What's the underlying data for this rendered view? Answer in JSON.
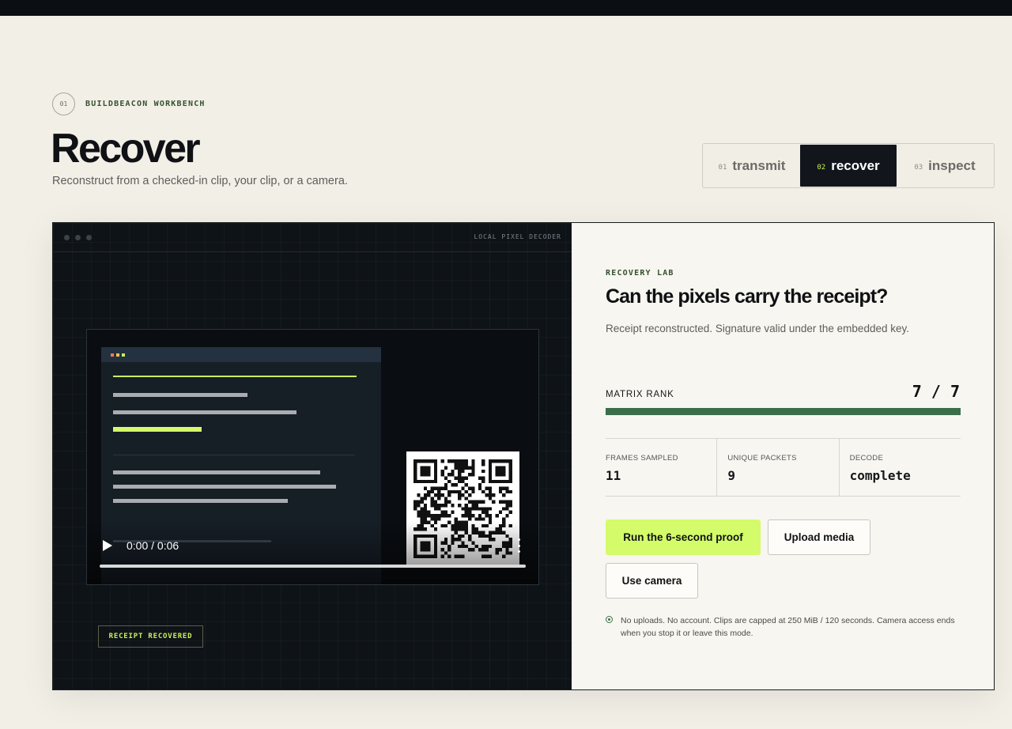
{
  "kicker": {
    "number": "01",
    "label": "BUILDBEACON WORKBENCH"
  },
  "page": {
    "title": "Recover",
    "subtitle": "Reconstruct from a checked-in clip, your clip, or a camera."
  },
  "modes": [
    {
      "num": "01",
      "label": "transmit",
      "active": false
    },
    {
      "num": "02",
      "label": "recover",
      "active": true
    },
    {
      "num": "03",
      "label": "inspect",
      "active": false
    }
  ],
  "viewer": {
    "label": "LOCAL PIXEL DECODER",
    "video_time": "0:00 / 0:06",
    "video_progress": 0,
    "badge": "RECEIPT RECOVERED"
  },
  "panel": {
    "eyebrow": "RECOVERY LAB",
    "headline": "Can the pixels carry the receipt?",
    "status": "Receipt reconstructed. Signature valid under the embedded key.",
    "rank_label": "MATRIX RANK",
    "rank_value": "7 / 7",
    "rank_fraction": 1.0,
    "stats": [
      {
        "label": "FRAMES SAMPLED",
        "value": "11"
      },
      {
        "label": "UNIQUE PACKETS",
        "value": "9"
      },
      {
        "label": "DECODE",
        "value": "complete"
      }
    ],
    "buttons": {
      "run": "Run the 6-second proof",
      "upload": "Upload media",
      "camera": "Use camera"
    },
    "note": "No uploads. No account. Clips are capped at 250 MiB / 120 seconds. Camera access ends when you stop it or leave this mode."
  },
  "colors": {
    "accent": "#d4fb6a",
    "rank_fill": "#3b6e4b",
    "dark": "#12161c"
  }
}
